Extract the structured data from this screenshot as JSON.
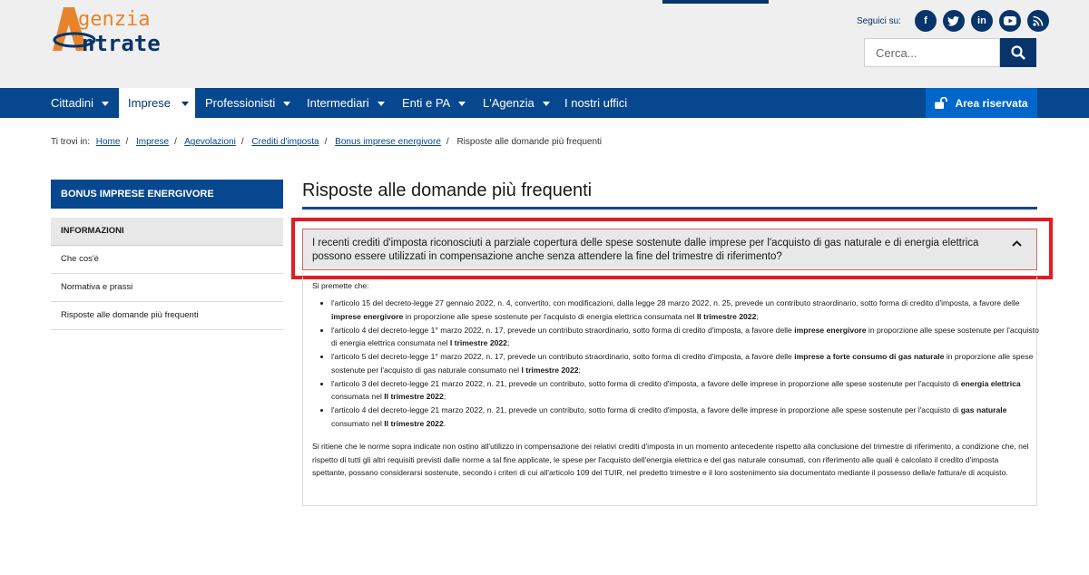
{
  "logo": {
    "line1": "genzia",
    "line2": "ntrate",
    "A": "A",
    "E": "E"
  },
  "social": {
    "label": "Seguici su:",
    "icons": [
      {
        "name": "facebook-icon",
        "glyph": "f"
      },
      {
        "name": "twitter-icon",
        "glyph": "t"
      },
      {
        "name": "linkedin-icon",
        "glyph": "in"
      },
      {
        "name": "youtube-icon",
        "glyph": "▶"
      },
      {
        "name": "rss-icon",
        "glyph": ")"
      }
    ]
  },
  "search": {
    "placeholder": "Cerca..."
  },
  "nav": {
    "items": [
      {
        "label": "Cittadini"
      },
      {
        "label": "Imprese"
      },
      {
        "label": "Professionisti"
      },
      {
        "label": "Intermediari"
      },
      {
        "label": "Enti e PA"
      },
      {
        "label": "L'Agenzia"
      },
      {
        "label": "I nostri uffici"
      }
    ],
    "reserved": "Area riservata"
  },
  "breadcrumb": {
    "prefix": "Ti trovi in:",
    "links": [
      "Home",
      "Imprese",
      "Agevolazioni",
      "Crediti d'imposta",
      "Bonus imprese energivore"
    ],
    "current": "Risposte alle domande più frequenti"
  },
  "sidebar": {
    "title": "BONUS IMPRESE ENERGIVORE",
    "section": "INFORMAZIONI",
    "items": [
      "Che cos'è",
      "Normativa e prassi",
      "Risposte alle domande più frequenti"
    ]
  },
  "page_title": "Risposte alle domande più frequenti",
  "question": "I recenti crediti d'imposta riconosciuti a parziale copertura delle spese sostenute dalle imprese per l'acquisto di gas naturale e di energia elettrica possono essere utilizzati in compensazione anche senza attendere la fine del trimestre di riferimento?",
  "answer": {
    "intro": "Si premette che:",
    "bullets": [
      {
        "a": "l'articolo 15 del decreto-legge 27 gennaio 2022, n. 4, convertito, con modificazioni, dalla legge 28 marzo 2022, n. 25, prevede un contributo straordinario, sotto forma di credito d'imposta, a favore delle ",
        "b1": "imprese energivore",
        "c": " in proporzione alle spese sostenute per l'acquisto di energia elettrica consumata nel ",
        "b2": "II trimestre 2022",
        "d": ";"
      },
      {
        "a": "l'articolo 4 del decreto-legge 1° marzo 2022, n. 17, prevede un contributo straordinario, sotto forma di credito d'imposta, a favore delle ",
        "b1": "imprese energivore",
        "c": " in proporzione alle spese sostenute per l'acquisto di energia elettrica consumata nel ",
        "b2": "I trimestre 2022",
        "d": ";"
      },
      {
        "a": "l'articolo 5 del decreto-legge 1° marzo 2022, n. 17, prevede un contributo straordinario, sotto forma di credito d'imposta, a favore delle ",
        "b1": "imprese a forte consumo di gas naturale",
        "c": " in proporzione alle spese sostenute per l'acquisto di gas naturale consumato nel ",
        "b2": "I trimestre 2022",
        "d": ";"
      },
      {
        "a": "l'articolo 3 del decreto-legge 21 marzo 2022, n. 21, prevede un contributo, sotto forma di credito d'imposta, a favore delle imprese in proporzione alle spese sostenute per l'acquisto di ",
        "b1": "energia elettrica",
        "c": " consumata nel ",
        "b2": "II trimestre 2022",
        "d": ";"
      },
      {
        "a": "l'articolo 4 del decreto-legge 21 marzo 2022, n. 21, prevede un contributo, sotto forma di credito d'imposta, a favore delle imprese in proporzione alle spese sostenute per l'acquisto di ",
        "b1": "gas naturale",
        "c": " consumato nel ",
        "b2": "II trimestre 2022",
        "d": "."
      }
    ],
    "paragraph": "Si ritiene che le norme sopra indicate non ostino all'utilizzo in compensazione dei relativi crediti d'imposta in un momento antecedente rispetto alla conclusione del trimestre di riferimento, a condizione che, nel rispetto di tutti gli altri requisiti previsti dalle norme a tal fine applicate, le spese per l'acquisto dell'energia elettrica e del gas naturale consumati, con riferimento alle quali è calcolato il credito d'imposta spettante, possano considerarsi sostenute, secondo i criteri di cui all'articolo 109 del TUIR, nel predetto trimestre e il loro sostenimento sia documentato mediante il possesso della/e fattura/e di acquisto."
  },
  "colors": {
    "brand": "#06478f",
    "accent": "#e8832a",
    "highlight": "#e31b23"
  }
}
